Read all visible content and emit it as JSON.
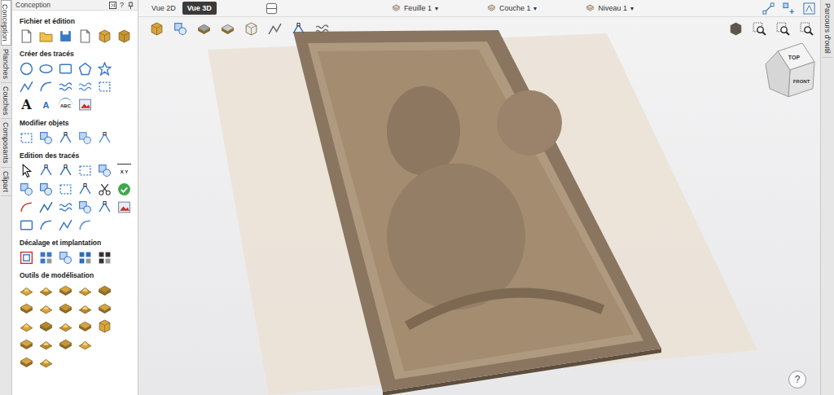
{
  "top_bar": {
    "view_tabs": [
      {
        "label": "Vue 2D",
        "selected": false
      },
      {
        "label": "Vue 3D",
        "selected": true
      }
    ],
    "dropdowns": [
      {
        "label": "Feuille 1",
        "caret": "▾"
      },
      {
        "label": "Couche 1",
        "caret": "▾"
      },
      {
        "label": "Niveau 1",
        "caret": "▾"
      }
    ]
  },
  "left_tabs": [
    {
      "label": "Conception",
      "selected": true
    },
    {
      "label": "Planches",
      "selected": false
    },
    {
      "label": "Couches",
      "selected": false
    },
    {
      "label": "Composants",
      "selected": false
    },
    {
      "label": "Clipart",
      "selected": false
    }
  ],
  "panel": {
    "title": "Conception",
    "help": "?",
    "sections": [
      {
        "title": "Fichier et édition",
        "glyphs": []
      },
      {
        "title": "Créer des tracés",
        "glyphs": [
          "A",
          "A",
          "ABC"
        ]
      },
      {
        "title": "Modifier objets",
        "glyphs": []
      },
      {
        "title": "Edition des tracés",
        "glyphs": [
          "X Y"
        ]
      },
      {
        "title": "Décalage et implantation",
        "glyphs": []
      },
      {
        "title": "Outils de modélisation",
        "glyphs": []
      }
    ]
  },
  "right_tabs": [
    {
      "label": "Parcours d'outil",
      "selected": false
    }
  ],
  "view_cube": {
    "top": "TOP",
    "front": "FRONT"
  },
  "help_button": "?"
}
